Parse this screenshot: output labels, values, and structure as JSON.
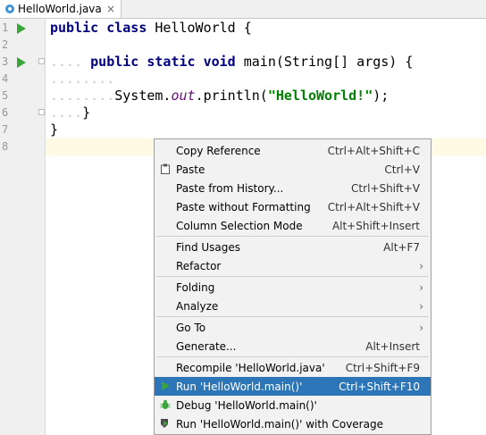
{
  "tab": {
    "title": "HelloWorld.java",
    "close": "×"
  },
  "lines": [
    {
      "num": "1"
    },
    {
      "num": "2"
    },
    {
      "num": "3"
    },
    {
      "num": "4"
    },
    {
      "num": "5"
    },
    {
      "num": "6"
    },
    {
      "num": "7"
    },
    {
      "num": "8"
    }
  ],
  "code": {
    "l1_kw1": "public",
    "l1_kw2": "class",
    "l1_name": " HelloWorld ",
    "l1_brace": "{",
    "l3_kw1": "public",
    "l3_kw2": "static",
    "l3_kw3": "void",
    "l3_rest": " main(String[] args) ",
    "l3_brace": "{",
    "l5_sys": "System.",
    "l5_out": "out",
    "l5_print": ".println(",
    "l5_str": "\"HelloWorld!\"",
    "l5_end": ");",
    "l6_brace": "}",
    "l7_brace": "}"
  },
  "menu": {
    "copy_reference": {
      "label": "Copy Reference",
      "shortcut": "Ctrl+Alt+Shift+C"
    },
    "paste": {
      "label": "Paste",
      "shortcut": "Ctrl+V"
    },
    "paste_history": {
      "label": "Paste from History...",
      "shortcut": "Ctrl+Shift+V"
    },
    "paste_no_format": {
      "label": "Paste without Formatting",
      "shortcut": "Ctrl+Alt+Shift+V"
    },
    "column_mode": {
      "label": "Column Selection Mode",
      "shortcut": "Alt+Shift+Insert"
    },
    "find_usages": {
      "label": "Find Usages",
      "shortcut": "Alt+F7"
    },
    "refactor": {
      "label": "Refactor"
    },
    "folding": {
      "label": "Folding"
    },
    "analyze": {
      "label": "Analyze"
    },
    "goto": {
      "label": "Go To"
    },
    "generate": {
      "label": "Generate...",
      "shortcut": "Alt+Insert"
    },
    "recompile": {
      "label": "Recompile 'HelloWorld.java'",
      "shortcut": "Ctrl+Shift+F9"
    },
    "run": {
      "label": "Run 'HelloWorld.main()'",
      "shortcut": "Ctrl+Shift+F10"
    },
    "debug": {
      "label": "Debug 'HelloWorld.main()'"
    },
    "run_coverage": {
      "label": "Run 'HelloWorld.main()' with Coverage"
    },
    "arrow": "›"
  },
  "colors": {
    "selection": "#2c76b8",
    "run_green": "#3aa53a",
    "keyword": "#000080",
    "string": "#008000"
  }
}
